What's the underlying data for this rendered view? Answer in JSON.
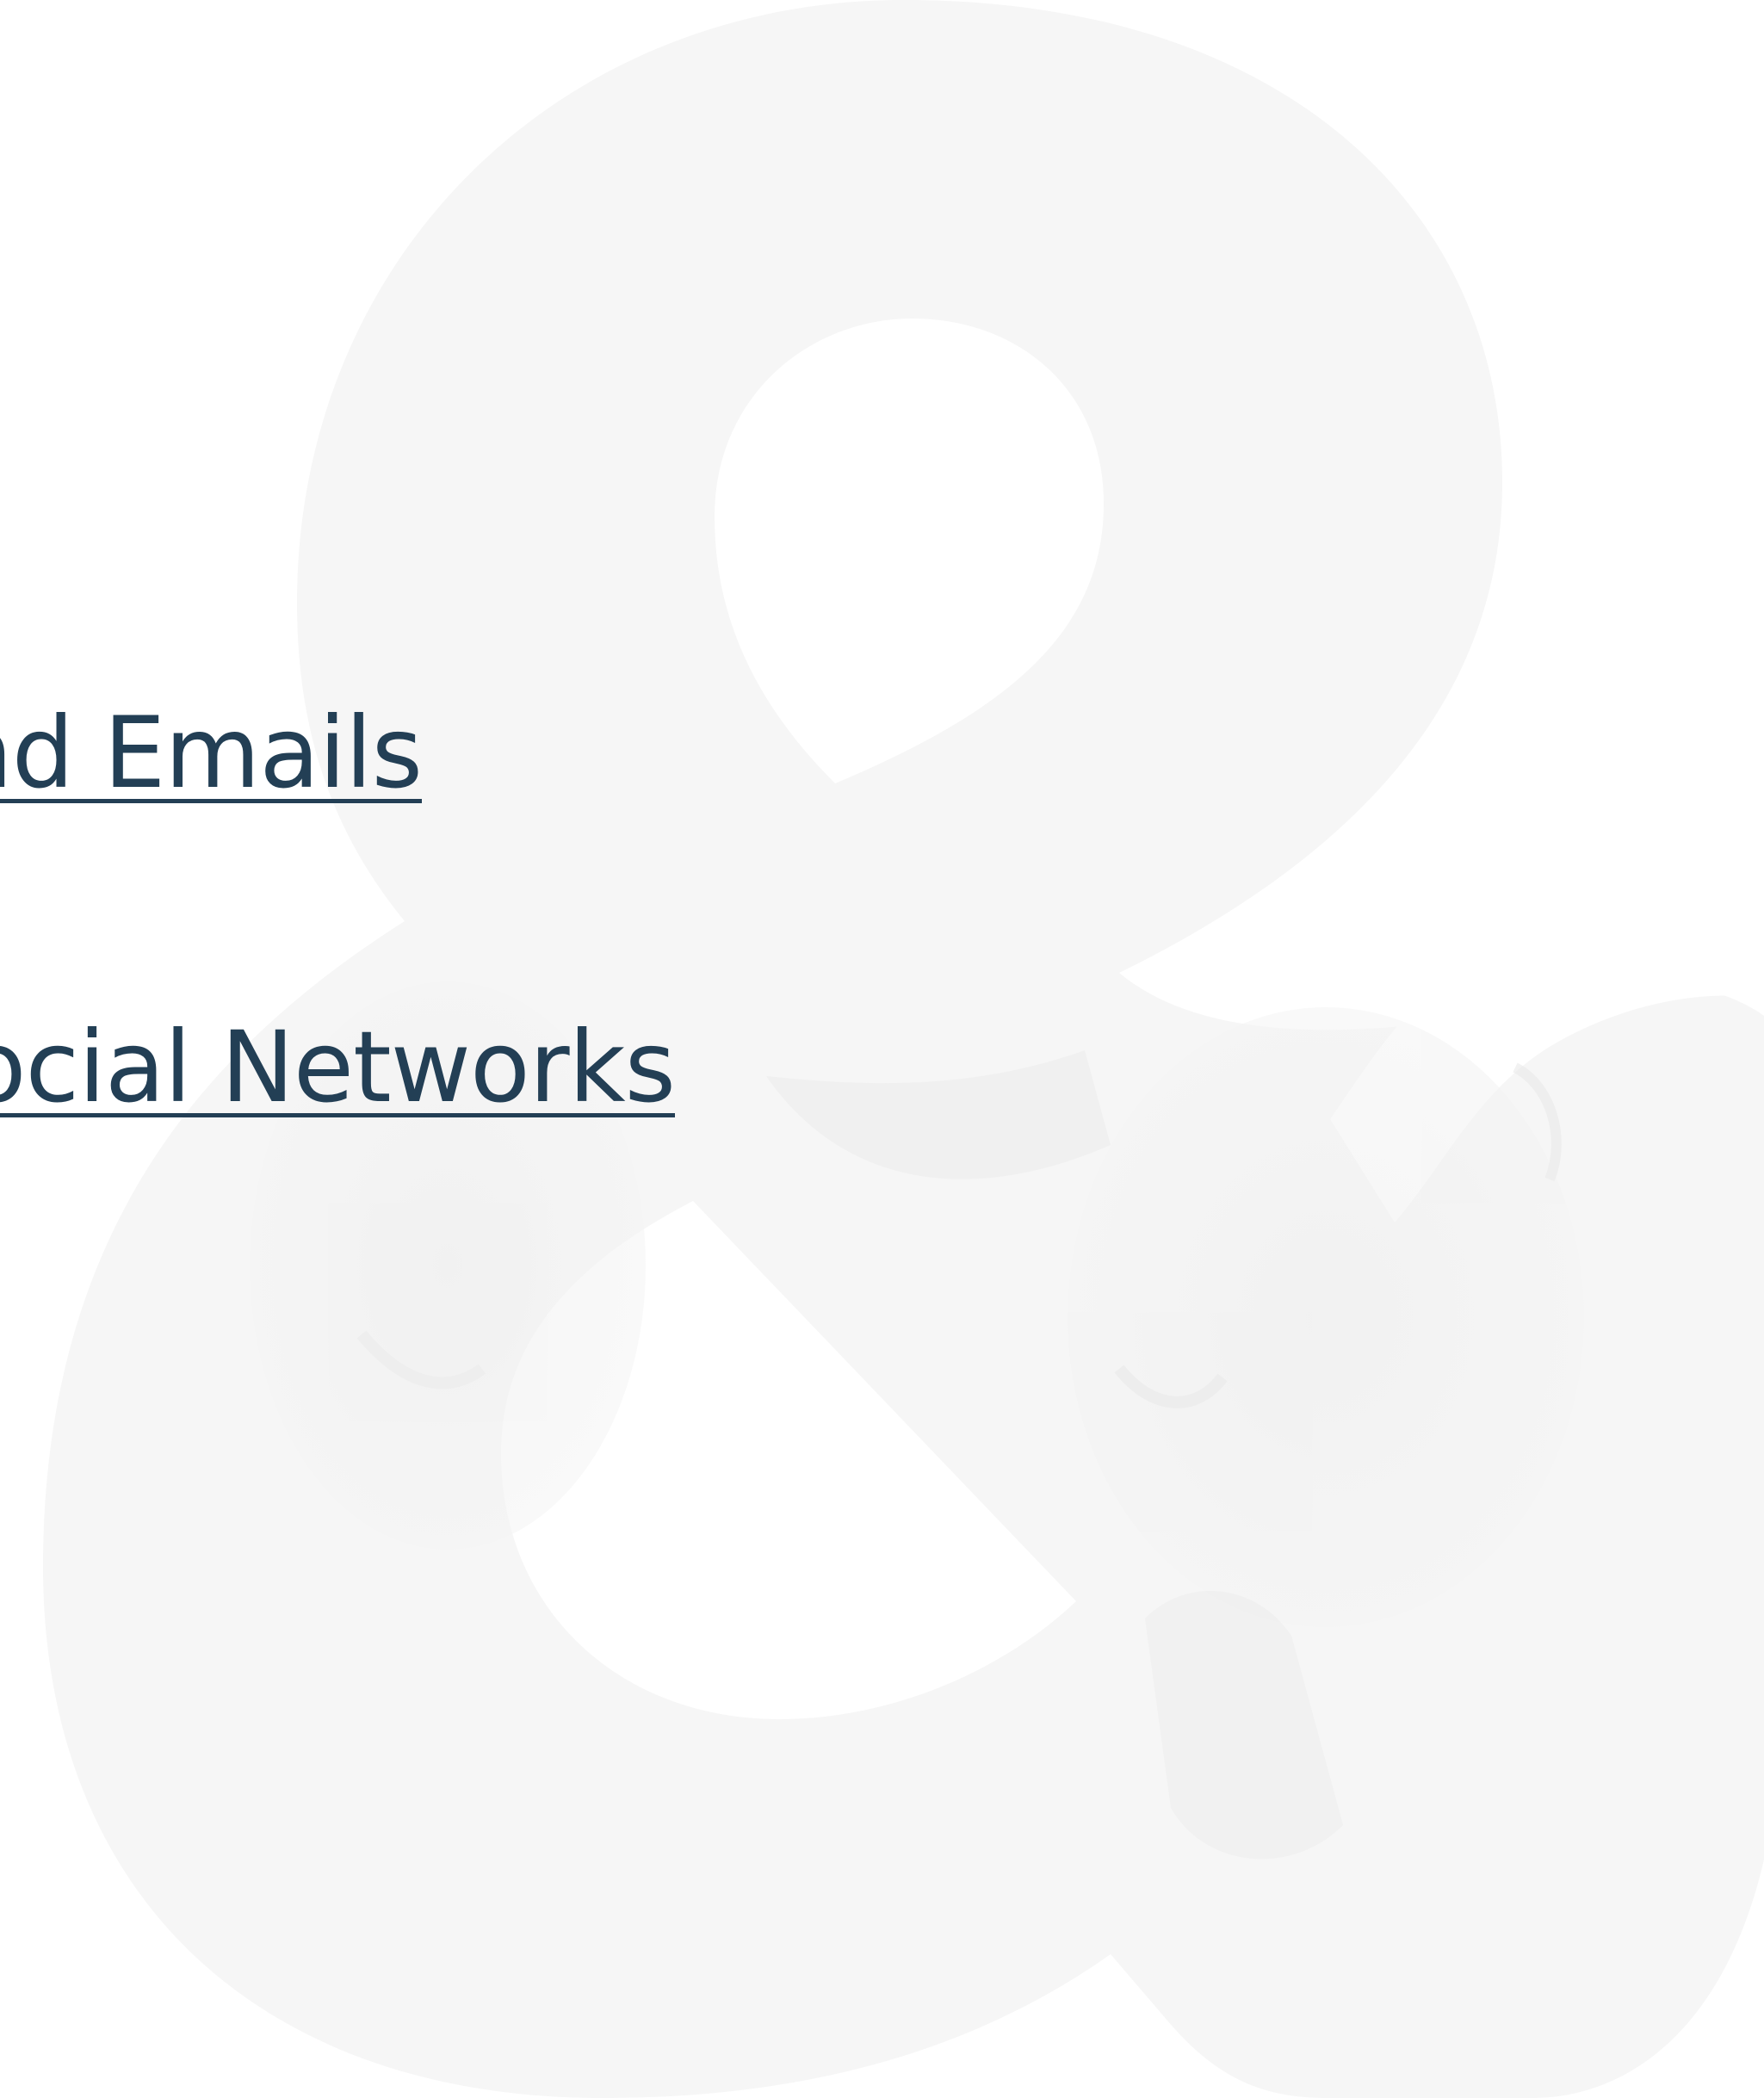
{
  "page": {
    "background_color": "#ffffff",
    "watermark": {
      "icon": "ampersand-icon",
      "glyph": "&",
      "photo_subject": "two men in caps talking",
      "fill_color": "#f6f6f6"
    }
  },
  "nav": {
    "link_color": "#233f55",
    "items": [
      {
        "label": "nd Emails"
      },
      {
        "label": "Social Networks"
      }
    ]
  }
}
